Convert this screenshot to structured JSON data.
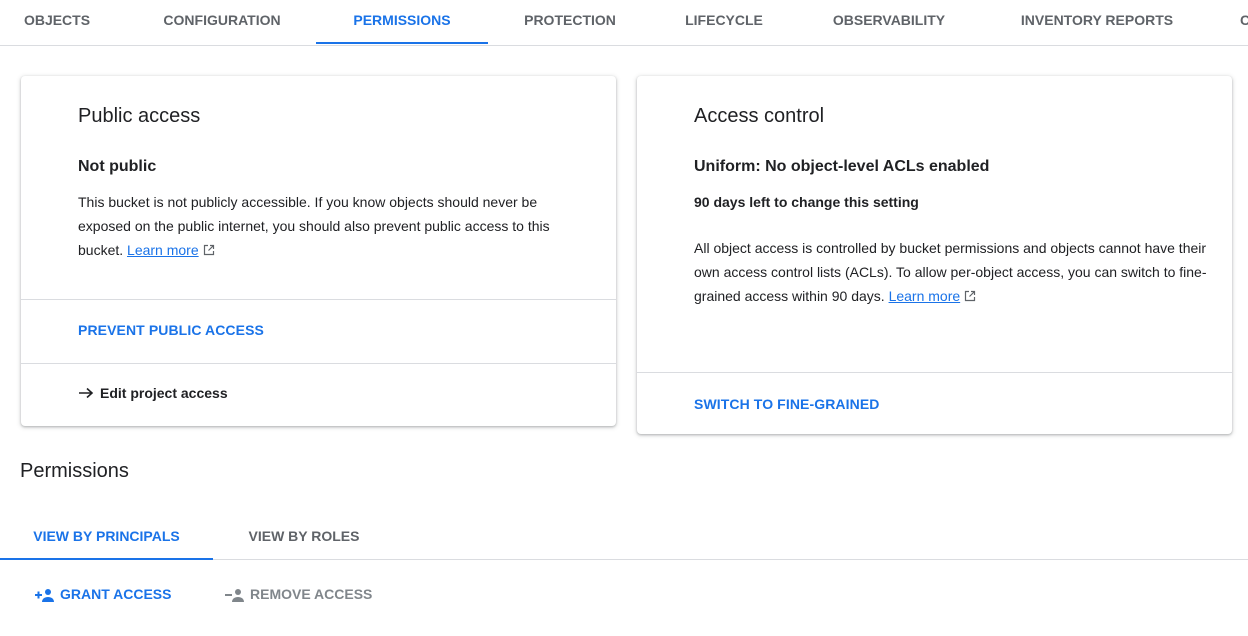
{
  "tabs": [
    {
      "label": "OBJECTS",
      "active": false
    },
    {
      "label": "CONFIGURATION",
      "active": false
    },
    {
      "label": "PERMISSIONS",
      "active": true
    },
    {
      "label": "PROTECTION",
      "active": false
    },
    {
      "label": "LIFECYCLE",
      "active": false
    },
    {
      "label": "OBSERVABILITY",
      "active": false
    },
    {
      "label": "INVENTORY REPORTS",
      "active": false
    },
    {
      "label": "C",
      "active": false
    }
  ],
  "public_access": {
    "title": "Public access",
    "status": "Not public",
    "description": "This bucket is not publicly accessible. If you know objects should never be exposed on the public internet, you should also prevent public access to this bucket.",
    "learn_more": "Learn more",
    "prevent_label": "PREVENT PUBLIC ACCESS",
    "edit_label": "Edit project access"
  },
  "access_control": {
    "title": "Access control",
    "mode": "Uniform: No object-level ACLs enabled",
    "days_left": "90 days left to change this setting",
    "description": "All object access is controlled by bucket permissions and objects cannot have their own access control lists (ACLs). To allow per-object access, you can switch to fine-grained access within 90 days.",
    "learn_more": "Learn more",
    "switch_label": "SWITCH TO FINE-GRAINED"
  },
  "permissions": {
    "title": "Permissions",
    "tabs": [
      {
        "label": "VIEW BY PRINCIPALS",
        "active": true
      },
      {
        "label": "VIEW BY ROLES",
        "active": false
      }
    ],
    "grant_label": "GRANT ACCESS",
    "remove_label": "REMOVE ACCESS"
  },
  "colors": {
    "accent": "#1a73e8",
    "text": "#202124",
    "muted": "#5f6368",
    "disabled": "#80868b",
    "divider": "#dadce0"
  },
  "icons": {
    "external_link": "open-in-new-icon",
    "arrow": "arrow-forward-icon",
    "grant": "person-add-icon",
    "remove": "person-remove-icon"
  }
}
